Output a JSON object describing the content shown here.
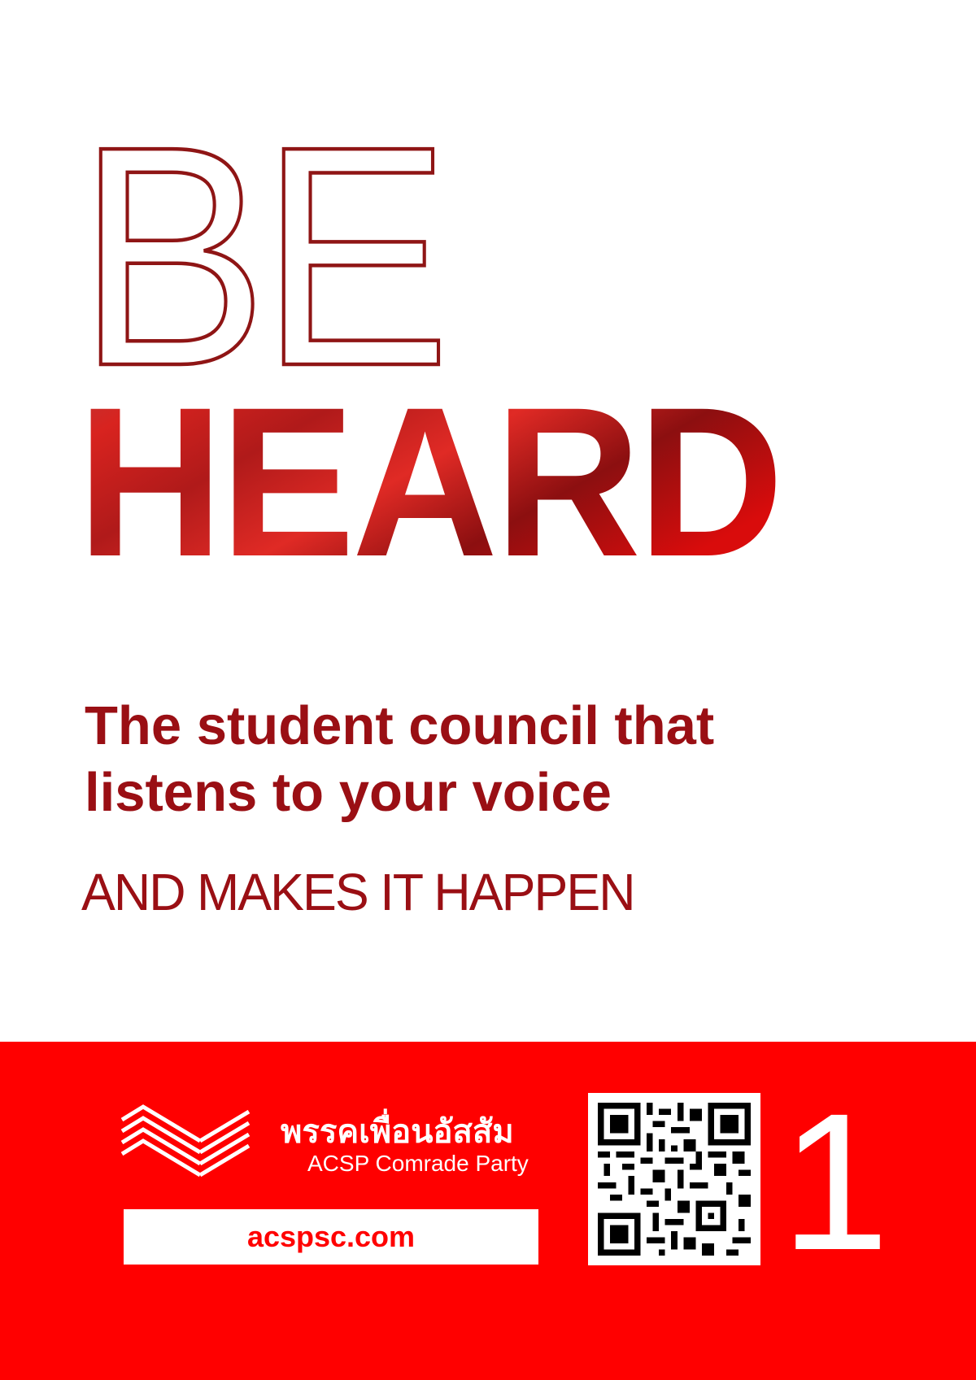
{
  "headline": {
    "line1": "BE",
    "line2": "HEARD"
  },
  "tagline": {
    "line1": "The student council that",
    "line2": "listens to your voice"
  },
  "subline": "AND MAKES IT HAPPEN",
  "footer": {
    "party_name_thai": "พรรคเพื่อนอัสสัม",
    "party_name_english": "ACSP Comrade Party",
    "website": "acspsc.com",
    "ballot_number": "1",
    "logo_icon": "chevron-stripes-icon",
    "qr_icon": "qr-code-icon"
  },
  "colors": {
    "dark_red": "#9a0f14",
    "bright_red": "#ff0000",
    "white": "#ffffff"
  }
}
